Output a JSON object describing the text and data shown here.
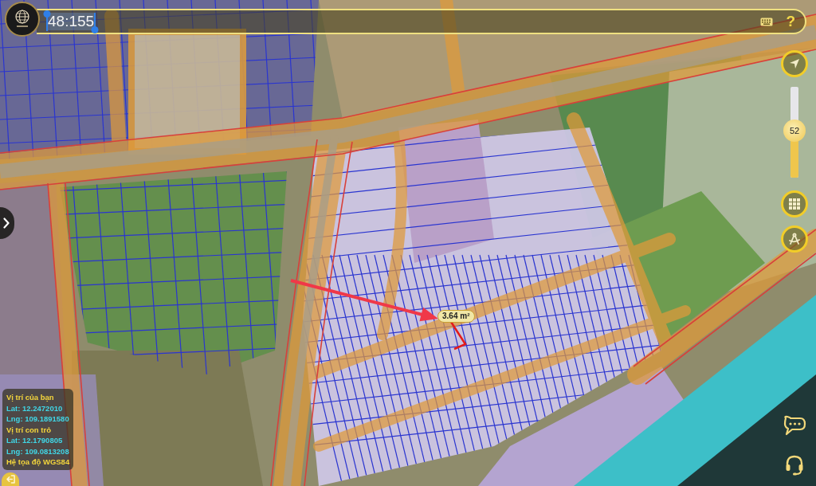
{
  "search": {
    "value": "48:155",
    "selected": true
  },
  "toolbar": {
    "help_label": "?"
  },
  "zoom": {
    "value": "52",
    "level": 0.52
  },
  "measurement": {
    "area": "3.64 m²"
  },
  "info_panel": {
    "lines": [
      {
        "kind": "heading",
        "text": "Vị trí của bạn"
      },
      {
        "kind": "value",
        "text": "Lat: 12.2472010"
      },
      {
        "kind": "value",
        "text": "Lng: 109.1891580"
      },
      {
        "kind": "heading",
        "text": "Vị trí con trỏ"
      },
      {
        "kind": "value",
        "text": "Lat: 12.1790805"
      },
      {
        "kind": "value",
        "text": "Lng: 109.0813208"
      },
      {
        "kind": "heading",
        "text": "Hệ tọa độ WGS84"
      }
    ]
  }
}
